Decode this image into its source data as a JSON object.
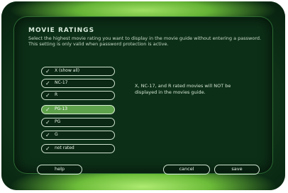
{
  "screen": {
    "title": "MOVIE RATINGS",
    "description": "Select the highest movie rating you want to display in the movie guide without entering a password. This setting is only valid when password protection is active."
  },
  "ratings": [
    {
      "label": "X (show all)",
      "checked": true,
      "selected": false
    },
    {
      "label": "NC-17",
      "checked": true,
      "selected": false
    },
    {
      "label": "R",
      "checked": true,
      "selected": false
    },
    {
      "label": "PG-13",
      "checked": true,
      "selected": true
    },
    {
      "label": "PG",
      "checked": true,
      "selected": false
    },
    {
      "label": "G",
      "checked": true,
      "selected": false
    },
    {
      "label": "not rated",
      "checked": true,
      "selected": false
    }
  ],
  "info_text": "X, NC-17, and R rated movies will NOT be displayed in the movies guide.",
  "buttons": {
    "help": "help",
    "cancel": "cancel",
    "save": "save"
  },
  "icons": {
    "check": "checkmark-icon"
  },
  "colors": {
    "selected": "#5ea24b",
    "background": "#0c2f17",
    "glow": "#8fdc52"
  }
}
